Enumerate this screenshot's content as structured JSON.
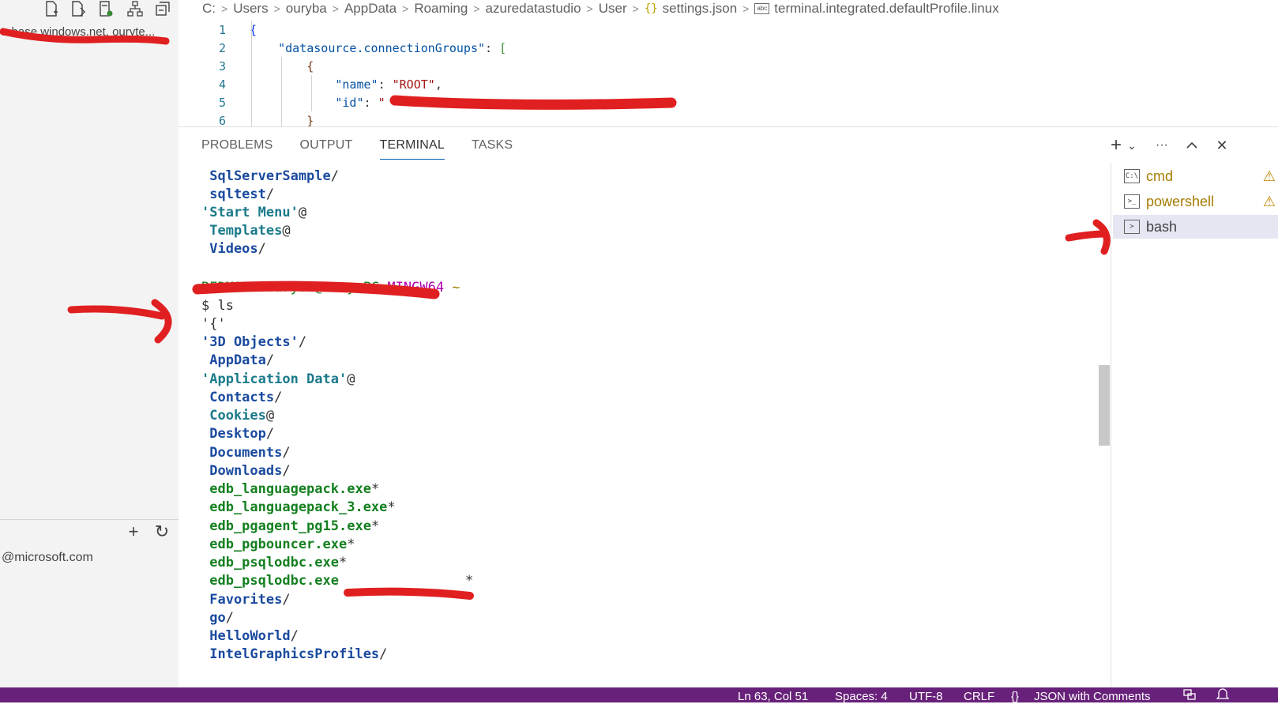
{
  "sidebar": {
    "connection_text": "tabase.windows.net, ouryte...",
    "account_text": "@microsoft.com",
    "top_icons": [
      "new-query-icon",
      "new-notebook-icon",
      "server-connected-icon",
      "server-group-icon",
      "collapse-all-icon"
    ],
    "actions": {
      "add_icon": "+",
      "refresh_icon": "↻"
    }
  },
  "breadcrumb": {
    "items": [
      "C:",
      "Users",
      "ouryba",
      "AppData",
      "Roaming",
      "azuredatastudio",
      "User"
    ],
    "json_icon": "{}",
    "file": "settings.json",
    "setting_icon": "abc",
    "setting": "terminal.integrated.defaultProfile.linux"
  },
  "editor": {
    "line_numbers": [
      "1",
      "2",
      "3",
      "4",
      "5",
      "6"
    ],
    "line1_brace": "{",
    "line2_key": "\"datasource.connectionGroups\"",
    "line2_colon": ": ",
    "line2_bracket": "[",
    "line3_brace": "{",
    "line4_key": "\"name\"",
    "line4_colon": ": ",
    "line4_value": "\"ROOT\"",
    "line4_comma": ",",
    "line5_key": "\"id\"",
    "line5_colon": ": ",
    "line5_value": "\"",
    "line5_end": "\"",
    "line6_brace": "}"
  },
  "panel": {
    "tabs": [
      "PROBLEMS",
      "OUTPUT",
      "TERMINAL",
      "TASKS"
    ],
    "active_tab": "TERMINAL",
    "actions": {
      "new_terminal": "+",
      "dropdown": "⌄",
      "more": "···",
      "maximize": "^",
      "close": "✕"
    }
  },
  "terminal": {
    "lines_before": [
      {
        "text": " SqlServerSample",
        "suffix": "/",
        "kind": "dir"
      },
      {
        "text": " sqltest",
        "suffix": "/",
        "kind": "dir"
      },
      {
        "text": "'Start Menu'",
        "suffix": "@",
        "kind": "lnk"
      },
      {
        "text": " Templates",
        "suffix": "@",
        "kind": "lnk"
      },
      {
        "text": " Videos",
        "suffix": "/",
        "kind": "dir"
      }
    ],
    "prompt": {
      "redacted": "REDMOND+ouryba@Oury-PC ",
      "mingw": "MINGW64",
      "tilde": " ~"
    },
    "command": "$ ls",
    "listing": [
      {
        "text": "'{'",
        "suffix": "",
        "kind": "plain"
      },
      {
        "text": "'3D Objects'",
        "suffix": "/",
        "kind": "dir"
      },
      {
        "text": " AppData",
        "suffix": "/",
        "kind": "dir"
      },
      {
        "text": "'Application Data'",
        "suffix": "@",
        "kind": "lnk"
      },
      {
        "text": " Contacts",
        "suffix": "/",
        "kind": "dir"
      },
      {
        "text": " Cookies",
        "suffix": "@",
        "kind": "lnk"
      },
      {
        "text": " Desktop",
        "suffix": "/",
        "kind": "dir"
      },
      {
        "text": " Documents",
        "suffix": "/",
        "kind": "dir"
      },
      {
        "text": " Downloads",
        "suffix": "/",
        "kind": "dir"
      },
      {
        "text": " edb_languagepack.exe",
        "suffix": "*",
        "kind": "exe"
      },
      {
        "text": " edb_languagepack_3.exe",
        "suffix": "*",
        "kind": "exe"
      },
      {
        "text": " edb_pgagent_pg15.exe",
        "suffix": "*",
        "kind": "exe"
      },
      {
        "text": " edb_pgbouncer.exe",
        "suffix": "*",
        "kind": "exe"
      },
      {
        "text": " edb_psqlodbc.exe",
        "suffix": "*",
        "kind": "exe"
      },
      {
        "text": " edb_psqlodbc.exe",
        "suffix": "*",
        "kind": "exe"
      },
      {
        "text": " Favorites",
        "suffix": "/",
        "kind": "dir"
      },
      {
        "text": " go",
        "suffix": "/",
        "kind": "dir"
      },
      {
        "text": " HelloWorld",
        "suffix": "/",
        "kind": "dir"
      },
      {
        "text": " IntelGraphicsProfiles",
        "suffix": "/",
        "kind": "dir"
      }
    ]
  },
  "terminal_list": [
    {
      "name": "cmd",
      "icon": "C:\\",
      "warning": true,
      "selected": false
    },
    {
      "name": "powershell",
      "icon": ">_",
      "warning": true,
      "selected": false
    },
    {
      "name": "bash",
      "icon": ">",
      "warning": false,
      "selected": true
    }
  ],
  "statusbar": {
    "position": "Ln 63, Col 51",
    "spaces": "Spaces: 4",
    "encoding": "UTF-8",
    "eol": "CRLF",
    "language_icon": "{}",
    "language": "JSON with Comments"
  },
  "colors": {
    "statusbar": "#68217a",
    "annotation": "#e02020",
    "dir": "#1a4a9e",
    "exe": "#148020",
    "link": "#1a7a8a"
  }
}
